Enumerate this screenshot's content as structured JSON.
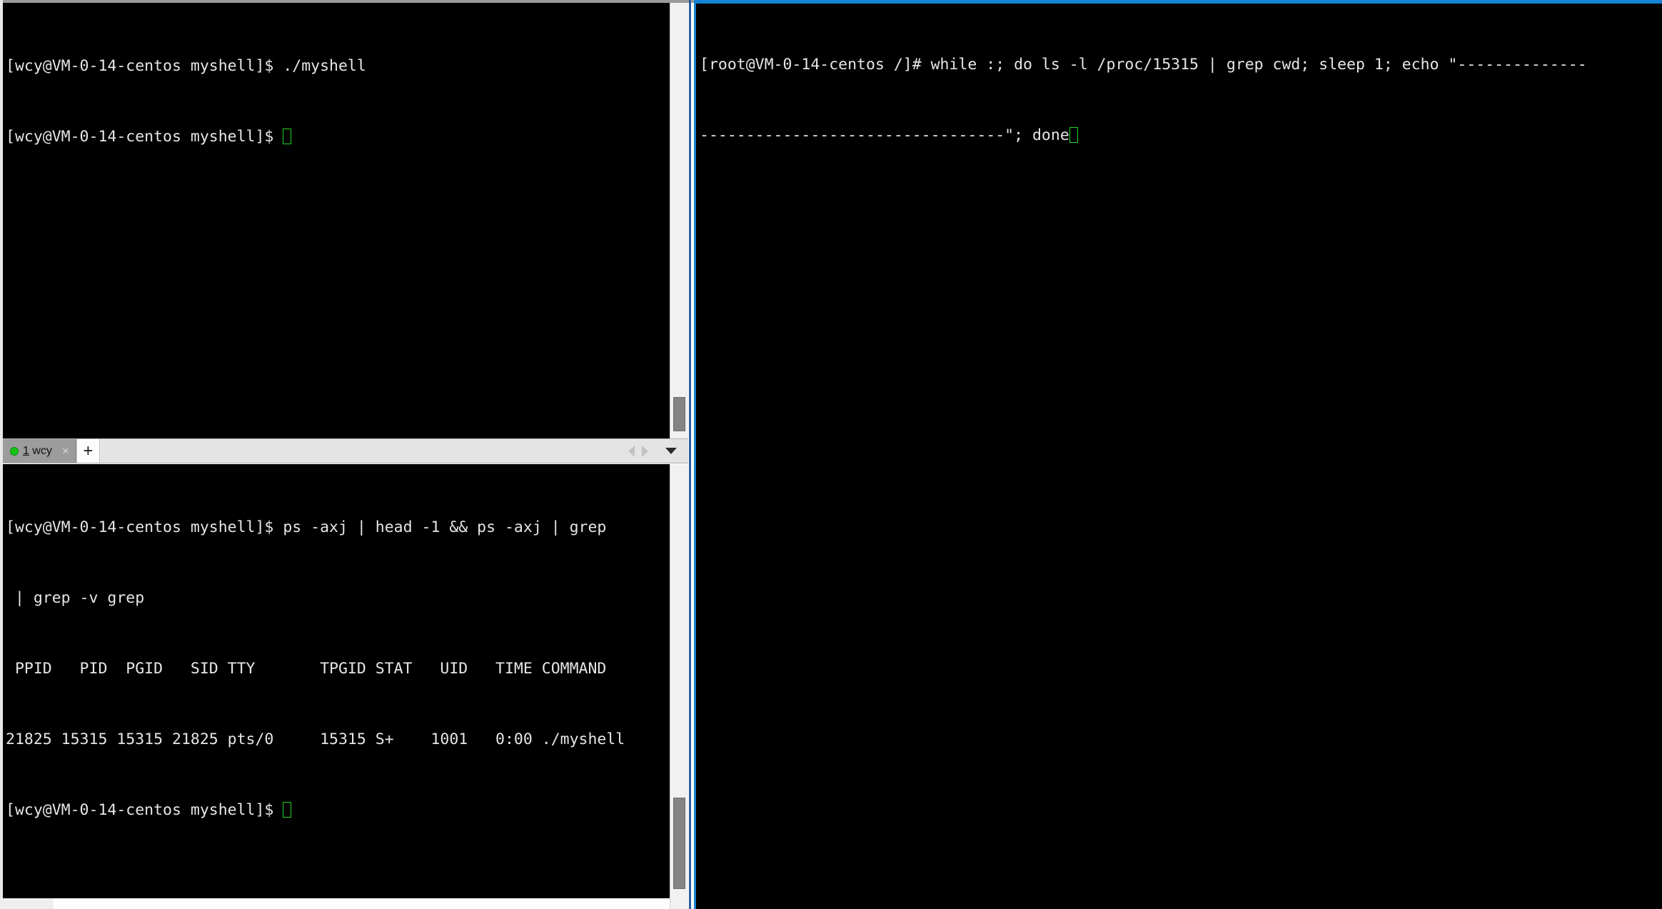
{
  "left_window": {
    "top_pane": {
      "lines": [
        "[wcy@VM-0-14-centos myshell]$ ./myshell",
        "[wcy@VM-0-14-centos myshell]$ "
      ],
      "cursor_visible": true
    },
    "tabbar": {
      "tab": {
        "status_dot_color": "#14c414",
        "index": "1",
        "name": " wcy",
        "close_label": "×"
      },
      "add_label": "+",
      "nav_prev_icon": "arrow-left-icon",
      "nav_next_icon": "arrow-right-icon",
      "menu_icon": "chevron-down-icon"
    },
    "bottom_pane": {
      "lines": [
        "[wcy@VM-0-14-centos myshell]$ ps -axj | head -1 && ps -axj | grep",
        " | grep -v grep",
        " PPID   PID  PGID   SID TTY       TPGID STAT   UID   TIME COMMAND",
        "21825 15315 15315 21825 pts/0     15315 S+    1001   0:00 ./myshell",
        "[wcy@VM-0-14-centos myshell]$ "
      ],
      "cursor_visible": true
    }
  },
  "right_window": {
    "accent_color": "#1383d6",
    "lines": [
      "[root@VM-0-14-centos /]# while :; do ls -l /proc/15315 | grep cwd; sleep 1; echo \"--------------",
      "---------------------------------\"; done"
    ],
    "cursor_visible": true
  }
}
